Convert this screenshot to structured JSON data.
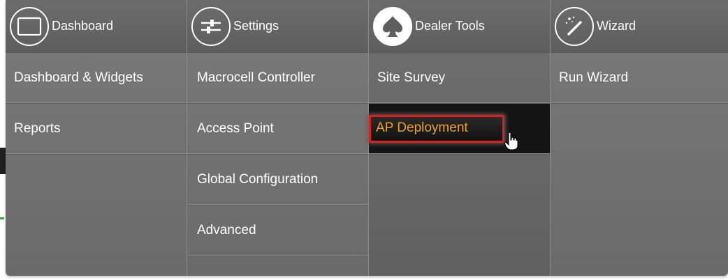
{
  "menu": {
    "columns": [
      {
        "title": "Dashboard",
        "icon": "monitor-icon",
        "items": [
          "Dashboard & Widgets",
          "Reports"
        ]
      },
      {
        "title": "Settings",
        "icon": "sliders-icon",
        "items": [
          "Macrocell Controller",
          "Access Point",
          "Global Configuration",
          "Advanced"
        ]
      },
      {
        "title": "Dealer Tools",
        "icon": "spade-icon",
        "items": [
          "Site Survey",
          "AP Deployment"
        ],
        "active_item": "AP Deployment"
      },
      {
        "title": "Wizard",
        "icon": "magic-wand-icon",
        "items": [
          "Run Wizard"
        ]
      }
    ]
  },
  "colors": {
    "menu_background": "#6e6e6e",
    "active_background": "#141414",
    "active_text": "#f0a020",
    "highlight_border": "#e21b1b",
    "text": "#ffffff"
  }
}
